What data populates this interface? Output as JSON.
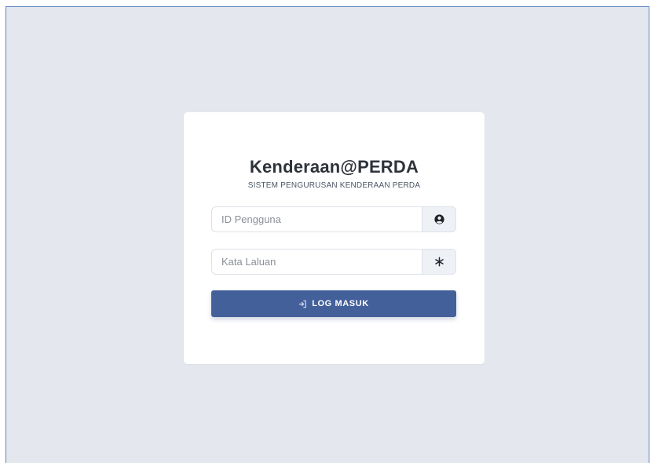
{
  "login": {
    "title": "Kenderaan@PERDA",
    "subtitle": "SISTEM PENGURUSAN KENDERAAN PERDA",
    "username": {
      "placeholder": "ID Pengguna",
      "value": "",
      "icon": "user-circle-icon"
    },
    "password": {
      "placeholder": "Kata Laluan",
      "value": "",
      "icon": "asterisk-icon"
    },
    "submit": {
      "label": "LOG MASUK",
      "icon": "sign-in-icon"
    }
  },
  "colors": {
    "background": "#e5e7ef",
    "card": "#ffffff",
    "button": "#43609b",
    "frame_border": "#5b86c7"
  }
}
